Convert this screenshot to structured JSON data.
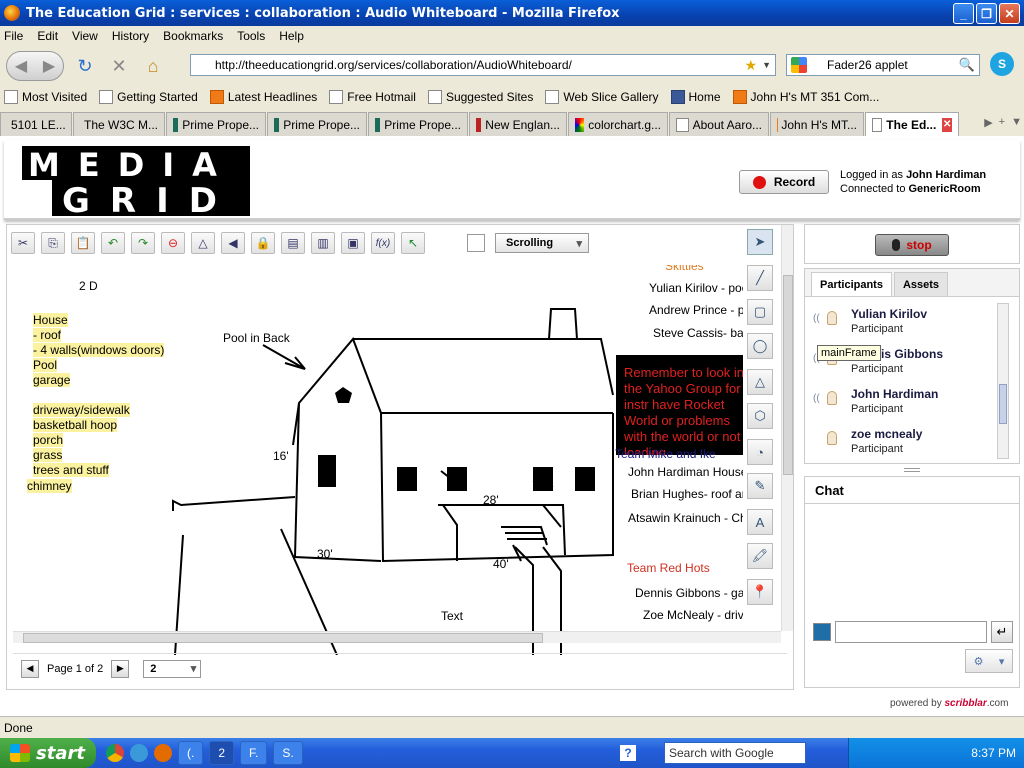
{
  "window": {
    "title": "The Education Grid : services : collaboration : Audio Whiteboard - Mozilla Firefox"
  },
  "menu": [
    "File",
    "Edit",
    "View",
    "History",
    "Bookmarks",
    "Tools",
    "Help"
  ],
  "address": {
    "url": "http://theeducationgrid.org/services/collaboration/AudioWhiteboard/"
  },
  "search": {
    "value": "Fader26 applet"
  },
  "bookmarks": [
    "Most Visited",
    "Getting Started",
    "Latest Headlines",
    "Free Hotmail",
    "Suggested Sites",
    "Web Slice Gallery",
    "Home",
    "John H's MT 351 Com..."
  ],
  "tabs": [
    "5101 LE...",
    "The W3C M...",
    "Prime Prope...",
    "Prime Prope...",
    "Prime Prope...",
    "New Englan...",
    "colorchart.g...",
    "About Aaro...",
    "John H's MT...",
    "The Ed..."
  ],
  "header": {
    "logo_top": "MEDIA",
    "logo_bottom": "GRID",
    "record_label": "Record",
    "logged_prefix": "Logged in as",
    "user": "John Hardiman",
    "connected_prefix": "Connected to",
    "room": "GenericRoom"
  },
  "whiteboard": {
    "scroll_mode": "Scrolling",
    "page_label": "Page 1 of 2",
    "page_select": "2",
    "left_notes": {
      "heading": "2 D",
      "items": [
        "House",
        "- roof",
        "- 4 walls(windows doors)",
        "Pool",
        "garage",
        "driveway/sidewalk",
        "basketball hoop",
        "porch",
        "grass",
        "trees and stuff",
        "chimney"
      ]
    },
    "pool_label": "Pool in Back",
    "dims": {
      "d16": "16'",
      "d28": "28'",
      "d30": "30'",
      "d40": "40'"
    },
    "bottom_text": "Text",
    "skittles": {
      "title": "Skittles",
      "lines": [
        "Yulian Kirilov - pool",
        "Andrew Prince - pool",
        "Steve Cassis- basketba"
      ]
    },
    "note": "Remember to look in the Yahoo Group for instr have Rocket World or problems with the world or not loading",
    "team_mike": {
      "title": "Team Mike and Ike",
      "lines": [
        "John Hardiman   House",
        "Brian Hughes- roof and wind",
        "Atsawin Krainuch - Chimne"
      ]
    },
    "team_red": {
      "title": "Team Red Hots",
      "lines": [
        "Dennis Gibbons - garage",
        "Zoe McNealy - drivewa"
      ]
    }
  },
  "audio": {
    "stop_label": "stop"
  },
  "participants_panel": {
    "tabs": [
      "Participants",
      "Assets"
    ],
    "tooltip": "mainFrame",
    "people": [
      {
        "name": "Yulian Kirilov",
        "role": "Participant"
      },
      {
        "name": "Dennis Gibbons",
        "role": "Participant"
      },
      {
        "name": "John Hardiman",
        "role": "Participant"
      },
      {
        "name": "zoe mcnealy",
        "role": "Participant"
      }
    ]
  },
  "chat": {
    "title": "Chat",
    "input_value": ""
  },
  "powered": {
    "prefix": "powered by",
    "brand": "scribblar",
    "suffix": ".com"
  },
  "status": {
    "text": "Done"
  },
  "taskbar": {
    "start": "start",
    "tasks": [
      "(.",
      "2",
      "F.",
      "S."
    ],
    "google_search": "Search with Google",
    "time": "8:37 PM"
  },
  "colors": {
    "note_bg": "#000000",
    "note_text": "#e12020",
    "highlight": "#fbf2a0",
    "accent_orange": "#e07a1e"
  }
}
